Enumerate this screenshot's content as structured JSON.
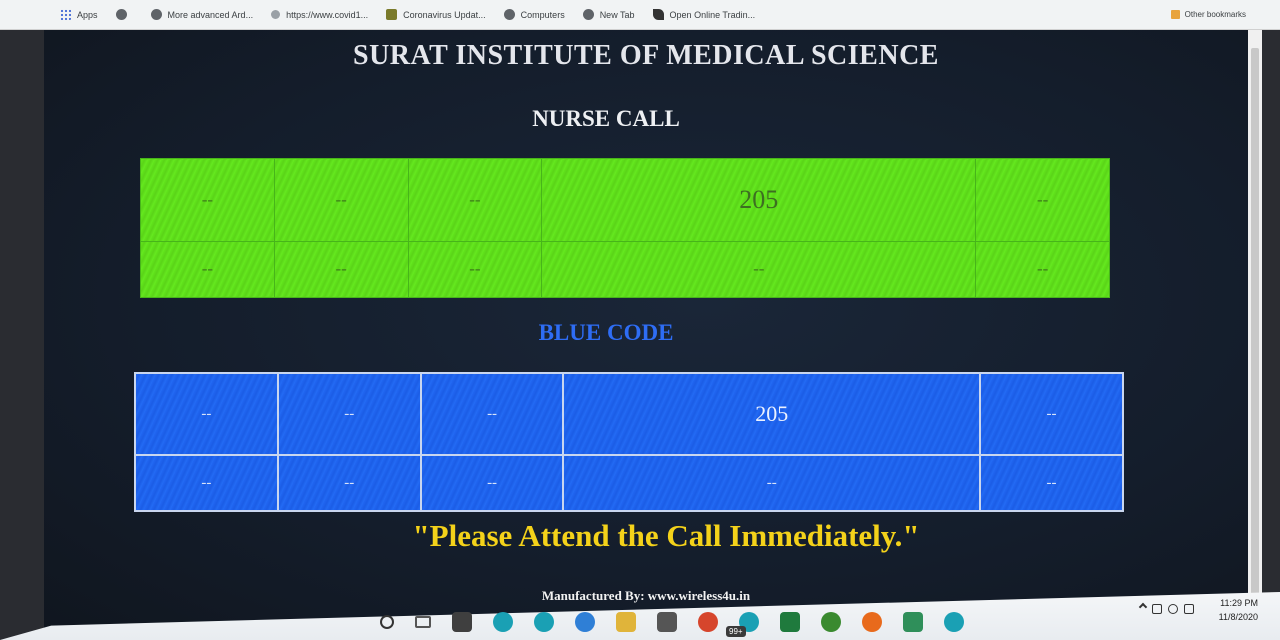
{
  "bookmarks": {
    "items": [
      {
        "label": "Apps",
        "icon": "apps-grid-icon"
      },
      {
        "label": "",
        "icon": "github-icon"
      },
      {
        "label": "More advanced Ard...",
        "icon": "github-icon"
      },
      {
        "label": "https://www.covid1...",
        "icon": "globe-icon"
      },
      {
        "label": "Coronavirus Updat...",
        "icon": "site-icon"
      },
      {
        "label": "Computers",
        "icon": "github-icon"
      },
      {
        "label": "New Tab",
        "icon": "github-icon"
      },
      {
        "label": "Open Online Tradin...",
        "icon": "leaf-icon"
      }
    ],
    "other": "Other bookmarks"
  },
  "page": {
    "title": "SURAT INSTITUTE OF MEDICAL SCIENCE",
    "nurse_call": {
      "heading": "NURSE CALL",
      "rows": [
        [
          "--",
          "--",
          "--",
          "205",
          "--"
        ],
        [
          "--",
          "--",
          "--",
          "--",
          "--"
        ]
      ],
      "color": "#5ee01a"
    },
    "blue_code": {
      "heading": "BLUE CODE",
      "rows": [
        [
          "--",
          "--",
          "--",
          "205",
          "--"
        ],
        [
          "--",
          "--",
          "--",
          "--",
          "--"
        ]
      ],
      "color": "#1f64ee"
    },
    "message": "\"Please Attend the Call Immediately.\"",
    "footer": "Manufactured By: www.wireless4u.in"
  },
  "taskbar": {
    "badge": "99+",
    "time": "11:29 PM",
    "date": "11/8/2020"
  }
}
